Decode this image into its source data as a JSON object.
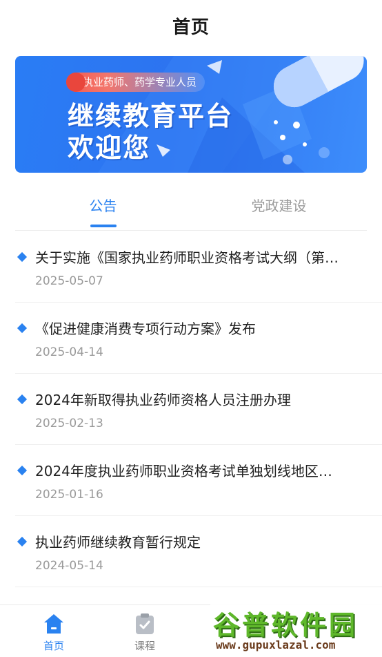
{
  "header": {
    "title": "首页"
  },
  "banner": {
    "tag": "执业药师、药学专业人员",
    "line1": "继续教育平台",
    "line2": "欢迎您"
  },
  "tabs": [
    {
      "label": "公告",
      "active": true
    },
    {
      "label": "党政建设",
      "active": false
    }
  ],
  "announcements": [
    {
      "title": "关于实施《国家执业药师职业资格考试大纲（第…",
      "date": "2025-05-07"
    },
    {
      "title": "《促进健康消费专项行动方案》发布",
      "date": "2025-04-14"
    },
    {
      "title": "2024年新取得执业药师资格人员注册办理",
      "date": "2025-02-13"
    },
    {
      "title": "2024年度执业药师职业资格考试单独划线地区…",
      "date": "2025-01-16"
    },
    {
      "title": "执业药师继续教育暂行规定",
      "date": "2024-05-14"
    }
  ],
  "bottom_nav": [
    {
      "label": "首页",
      "icon": "home-icon",
      "active": true
    },
    {
      "label": "课程",
      "icon": "clipboard-check-icon",
      "active": false
    }
  ],
  "watermark": {
    "brand": "谷普软件园",
    "url": "www.gupuxlazal.com"
  },
  "colors": {
    "accent": "#2a82f0",
    "banner": "#2d73f0",
    "muted": "#9a9a9a",
    "watermark_green": "#5fb82b"
  }
}
